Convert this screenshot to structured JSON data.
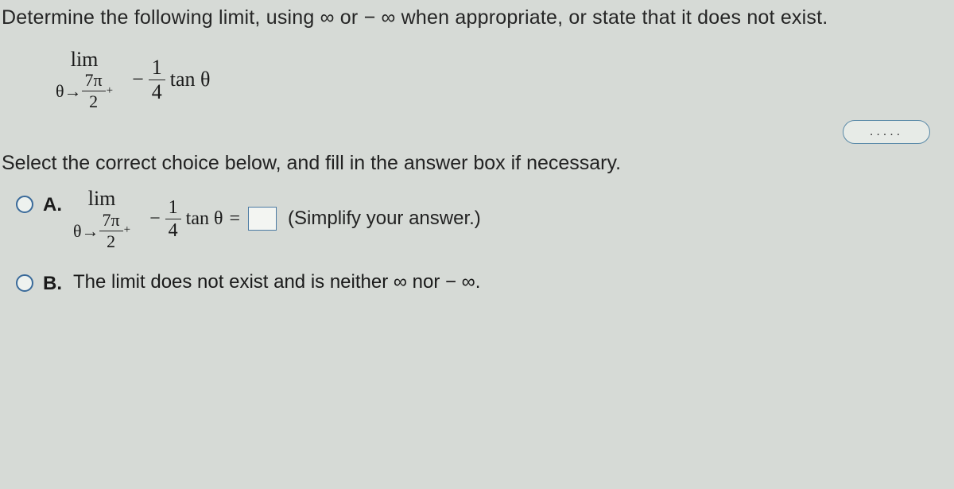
{
  "prompt": "Determine the following limit, using ∞ or − ∞ when appropriate, or state that it does not exist.",
  "expression": {
    "lim": "lim",
    "theta": "θ→",
    "frac_num": "7π",
    "frac_den": "2",
    "sup": "+",
    "minus": "−",
    "coef_num": "1",
    "coef_den": "4",
    "tan": "tan θ"
  },
  "more": ".....",
  "instruction": "Select the correct choice below, and fill in the answer box if necessary.",
  "choices": {
    "a_label": "A.",
    "a_eq": "=",
    "a_hint": "(Simplify your answer.)",
    "b_label": "B.",
    "b_text": "The limit does not exist and is neither ∞ nor − ∞."
  }
}
